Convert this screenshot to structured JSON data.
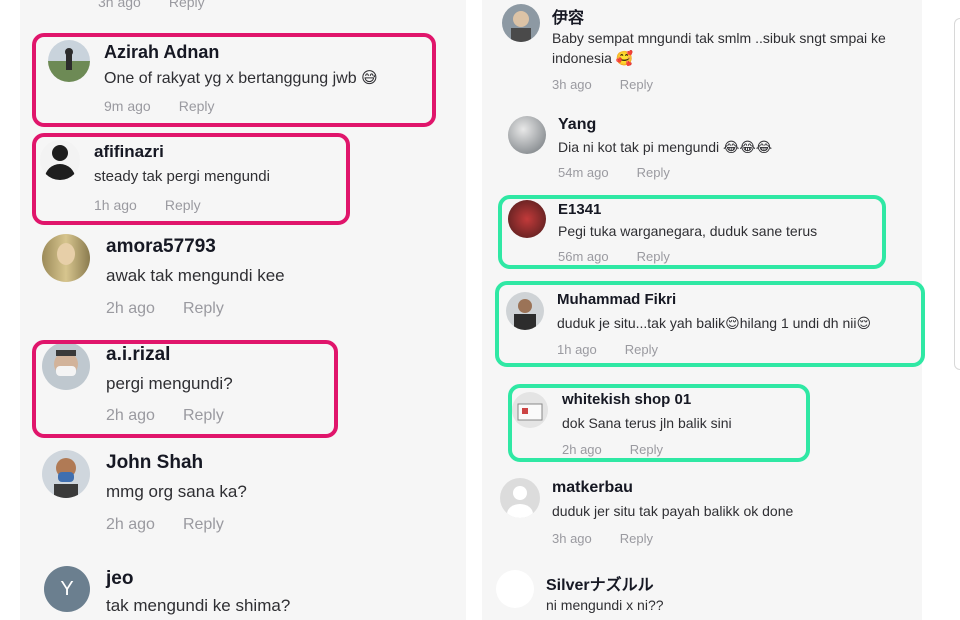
{
  "left": {
    "top_partial": {
      "time": "3h ago",
      "reply": "Reply"
    },
    "comments": [
      {
        "username": "Azirah Adnan",
        "text": "One of rakyat yg x bertanggung jwb 😅",
        "time": "9m ago",
        "reply": "Reply"
      },
      {
        "username": "afifinazri",
        "text": "steady tak pergi mengundi",
        "time": "1h ago",
        "reply": "Reply"
      },
      {
        "username": "amora57793",
        "text": "awak tak mengundi kee",
        "time": "2h ago",
        "reply": "Reply"
      },
      {
        "username": "a.i.rizal",
        "text": "pergi mengundi?",
        "time": "2h ago",
        "reply": "Reply"
      },
      {
        "username": "John Shah",
        "text": "mmg org sana ka?",
        "time": "2h ago",
        "reply": "Reply"
      },
      {
        "username": "jeo",
        "text": "tak mengundi ke shima?",
        "avatar_letter": "Y"
      }
    ]
  },
  "right": {
    "comments": [
      {
        "username": "伊容",
        "text_line1": "Baby sempat mngundi tak smlm ..sibuk sngt smpai ke",
        "text_line2": "indonesia 🥰",
        "time": "3h ago",
        "reply": "Reply"
      },
      {
        "username": "Yang",
        "text": "Dia ni kot tak pi mengundi 😂😂😂",
        "time": "54m ago",
        "reply": "Reply"
      },
      {
        "username": "E1341",
        "text": "Pegi tuka warganegara, duduk sane terus",
        "time": "56m ago",
        "reply": "Reply"
      },
      {
        "username": "Muhammad Fikri",
        "text": "duduk je situ...tak yah balik😌hilang 1 undi dh nii😌",
        "time": "1h ago",
        "reply": "Reply"
      },
      {
        "username": "whitekish shop 01",
        "text": "dok Sana terus jln balik sini",
        "time": "2h ago",
        "reply": "Reply"
      },
      {
        "username": "matkerbau",
        "text": "duduk jer situ tak payah balikk ok done",
        "time": "3h ago",
        "reply": "Reply"
      },
      {
        "username": "Silverナズルル",
        "text": "ni mengundi x ni??"
      }
    ]
  },
  "colors": {
    "pink_highlight": "#e0156b",
    "green_highlight": "#2fe8a4",
    "meta_gray": "#9a9aa0"
  }
}
